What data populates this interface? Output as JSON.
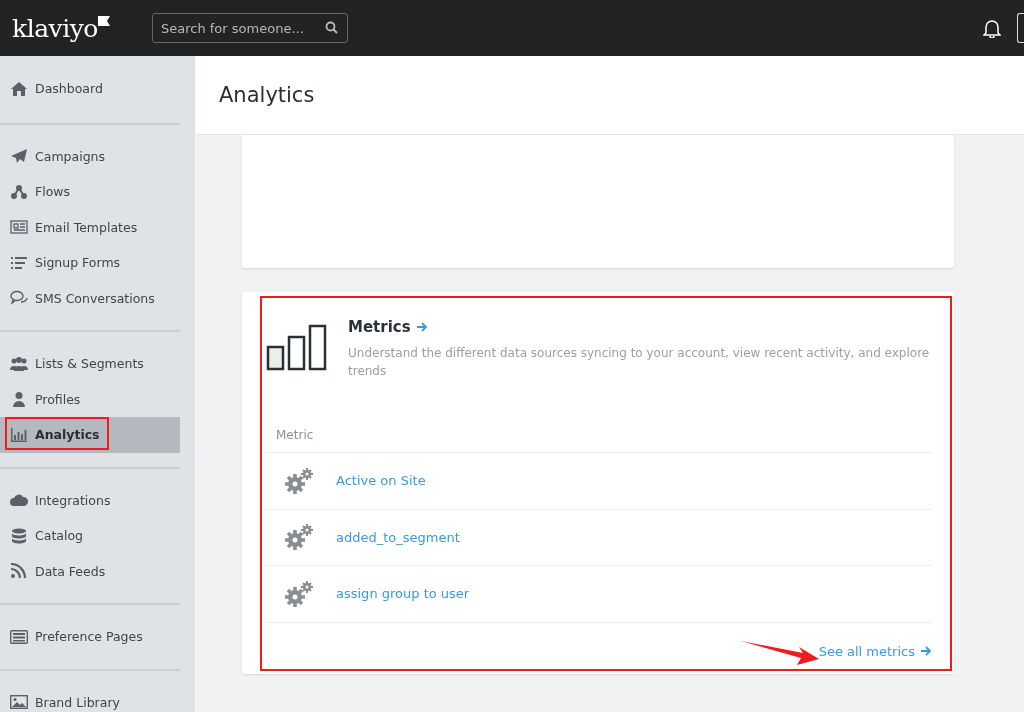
{
  "top_bar": {
    "logo": "klaviyo",
    "search": {
      "placeholder": "Search for someone..."
    }
  },
  "sidebar": {
    "groups": [
      {
        "items": [
          {
            "label": "Dashboard",
            "selected": false,
            "highlighted": false
          }
        ]
      },
      {
        "items": [
          {
            "label": "Campaigns",
            "selected": false,
            "highlighted": false
          },
          {
            "label": "Flows",
            "selected": false,
            "highlighted": false
          },
          {
            "label": "Email Templates",
            "selected": false,
            "highlighted": false
          },
          {
            "label": "Signup Forms",
            "selected": false,
            "highlighted": false
          },
          {
            "label": "SMS Conversations",
            "selected": false,
            "highlighted": false
          }
        ]
      },
      {
        "items": [
          {
            "label": "Lists & Segments",
            "selected": false,
            "highlighted": false
          },
          {
            "label": "Profiles",
            "selected": false,
            "highlighted": false
          },
          {
            "label": "Analytics",
            "selected": true,
            "highlighted": true
          }
        ]
      },
      {
        "items": [
          {
            "label": "Integrations",
            "selected": false,
            "highlighted": false
          },
          {
            "label": "Catalog",
            "selected": false,
            "highlighted": false
          },
          {
            "label": "Data Feeds",
            "selected": false,
            "highlighted": false
          }
        ]
      },
      {
        "items": [
          {
            "label": "Preference Pages",
            "selected": false,
            "highlighted": false
          }
        ]
      },
      {
        "items": [
          {
            "label": "Brand Library",
            "selected": false,
            "highlighted": false
          }
        ]
      }
    ]
  },
  "page": {
    "title": "Analytics"
  },
  "metrics_card": {
    "highlighted": true,
    "title": "Metrics",
    "description": "Understand the different data sources syncing to your account, view recent activity, and explore trends",
    "column_header": "Metric",
    "rows": [
      {
        "name": "Active on Site"
      },
      {
        "name": "added_to_segment"
      },
      {
        "name": "assign group to user"
      }
    ],
    "footer_link": {
      "label": "See all metrics",
      "annotated": true
    }
  }
}
